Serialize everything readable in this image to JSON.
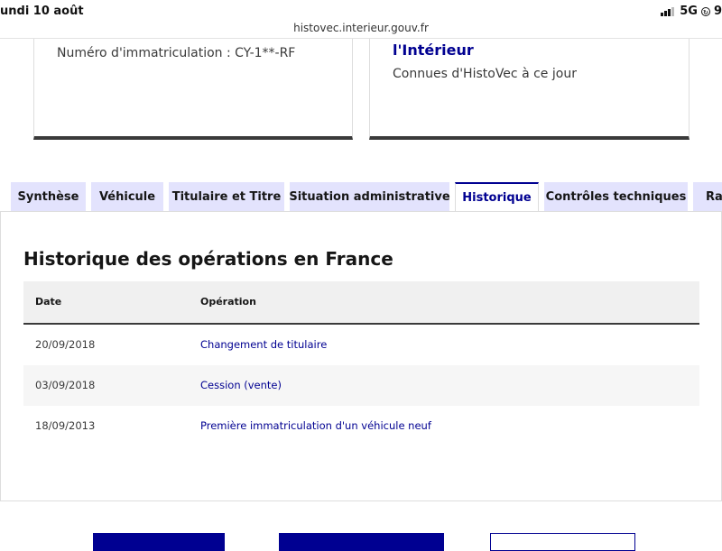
{
  "status_bar": {
    "date": "undi 10 août",
    "network": "5G",
    "battery_partial": "9"
  },
  "browser": {
    "url": "histovec.interieur.gouv.fr"
  },
  "cards": {
    "left": {
      "plate_line": "Numéro d'immatriculation : CY-1**-RF"
    },
    "right": {
      "title": "l'Intérieur",
      "subtitle": "Connues d'HistoVec à ce jour"
    }
  },
  "tabs": [
    {
      "label": "Synthèse",
      "active": false
    },
    {
      "label": "Véhicule",
      "active": false
    },
    {
      "label": "Titulaire et Titre",
      "active": false
    },
    {
      "label": "Situation administrative",
      "active": false
    },
    {
      "label": "Historique",
      "active": true
    },
    {
      "label": "Contrôles techniques",
      "active": false
    },
    {
      "label": "Rap",
      "active": false
    }
  ],
  "history": {
    "title": "Historique des opérations en France",
    "columns": {
      "date": "Date",
      "operation": "Opération"
    },
    "rows": [
      {
        "date": "20/09/2018",
        "operation": "Changement de titulaire"
      },
      {
        "date": "03/09/2018",
        "operation": "Cession (vente)"
      },
      {
        "date": "18/09/2013",
        "operation": "Première immatriculation d'un véhicule neuf"
      }
    ]
  },
  "colors": {
    "brand_blue": "#000091",
    "tab_inactive_bg": "#e3e3fd",
    "row_alt_bg": "#f6f6f6"
  }
}
